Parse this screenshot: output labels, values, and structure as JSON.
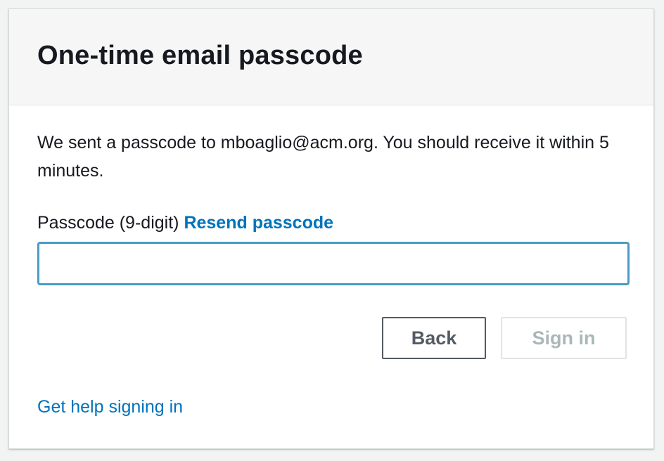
{
  "header": {
    "title": "One-time email passcode"
  },
  "body": {
    "intro_text": "We sent a passcode to mboaglio@acm.org. You should receive it within 5 minutes.",
    "passcode_label": "Passcode (9-digit)",
    "resend_link": "Resend passcode",
    "passcode_value": ""
  },
  "actions": {
    "back_label": "Back",
    "signin_label": "Sign in",
    "signin_disabled": true
  },
  "footer": {
    "help_link": "Get help signing in"
  },
  "colors": {
    "link": "#0073bb",
    "input_focus_border": "#4a9bc1",
    "header_background": "#f6f6f6",
    "title_text": "#16191f",
    "disabled_text": "#aab7b8"
  }
}
